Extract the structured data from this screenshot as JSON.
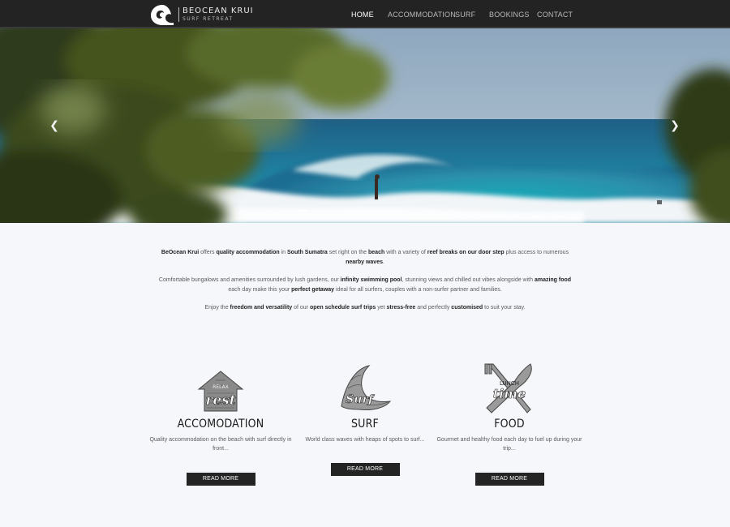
{
  "brand": {
    "name": "BEOCEAN KRUI",
    "tagline": "SURF RETREAT"
  },
  "nav": {
    "items": [
      {
        "label": "HOME",
        "active": true
      },
      {
        "label": "ACCOMMODATION",
        "active": false
      },
      {
        "label": "SURF",
        "active": false
      },
      {
        "label": "BOOKINGS",
        "active": false
      },
      {
        "label": "CONTACT",
        "active": false
      }
    ]
  },
  "slider": {
    "prev_icon": "chevron-left-icon",
    "next_icon": "chevron-right-icon",
    "slide_count": 8,
    "active_slide": 1
  },
  "intro": {
    "p1": {
      "a": "BeOcean Krui",
      "b": " offers ",
      "c": "quality accommodation",
      "d": " in ",
      "e": "South Sumatra",
      "f": " set right on the ",
      "g": "beach",
      "h": " with a variety of ",
      "i": "reef breaks on our door step",
      "j": " plus access to numerous ",
      "k": "nearby waves",
      "l": "."
    },
    "p2": {
      "a": "Comfortable bungalows and amenities surrounded by lush gardens, our ",
      "b": "infinity swimming pool",
      "c": ", stunning views and chilled out vibes alongside with ",
      "d": "amazing food",
      "e": " each day make this your ",
      "f": "perfect getaway",
      "g": " ideal for all surfers, couples with a non-surfer partner and families."
    },
    "p3": {
      "a": "Enjoy the ",
      "b": "freedom and versatility",
      "c": " of our ",
      "d": "open schedule surf trips",
      "e": " yet ",
      "f": "stress-free",
      "g": " and perfectly ",
      "h": "customised",
      "i": " to suit your stay."
    }
  },
  "features": [
    {
      "icon": "rest-house-icon",
      "icon_words": [
        "RELAX",
        "rest"
      ],
      "title": "ACCOMODATION",
      "desc": "Quality accommodation on the beach with surf directly in front...",
      "button": "READ MORE"
    },
    {
      "icon": "surf-wave-icon",
      "icon_words": [
        "Surf"
      ],
      "title": "SURF",
      "desc": "World class waves with heaps of spots to surf...",
      "button": "READ MORE"
    },
    {
      "icon": "fork-knife-icon",
      "icon_words": [
        "LUNCH",
        "time"
      ],
      "title": "FOOD",
      "desc": "Gourmet and healthy food each day to fuel up during your trip...",
      "button": "READ MORE"
    }
  ],
  "colors": {
    "header_bg": "#232323",
    "page_bg": "#f6f7fb",
    "button_bg": "#242424",
    "ocean": "#1f7f9f",
    "sky": "#9fb6c8"
  }
}
